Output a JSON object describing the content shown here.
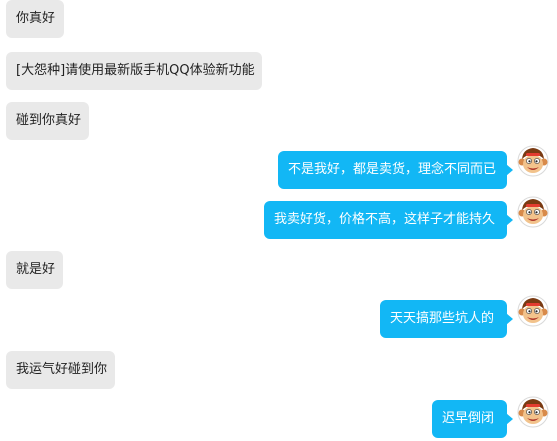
{
  "chat": {
    "messages": [
      {
        "side": "left",
        "text": "你真好"
      },
      {
        "side": "left",
        "text": "[大怨种]请使用最新版手机QQ体验新功能"
      },
      {
        "side": "left",
        "text": "碰到你真好"
      },
      {
        "side": "right",
        "text": "不是我好，都是卖货，理念不同而已",
        "avatar": "monkey-avatar-icon"
      },
      {
        "side": "right",
        "text": "我卖好货，价格不高，这样子才能持久",
        "avatar": "monkey-avatar-icon"
      },
      {
        "side": "left",
        "text": "就是好"
      },
      {
        "side": "right",
        "text": "天天搞那些坑人的",
        "avatar": "monkey-avatar-icon"
      },
      {
        "side": "left",
        "text": "我运气好碰到你"
      },
      {
        "side": "right",
        "text": "迟早倒闭",
        "avatar": "monkey-avatar-icon"
      }
    ]
  },
  "colors": {
    "self_bubble": "#12b7f5",
    "other_bubble": "#e9e9e9",
    "self_text": "#ffffff",
    "other_text": "#222222"
  }
}
